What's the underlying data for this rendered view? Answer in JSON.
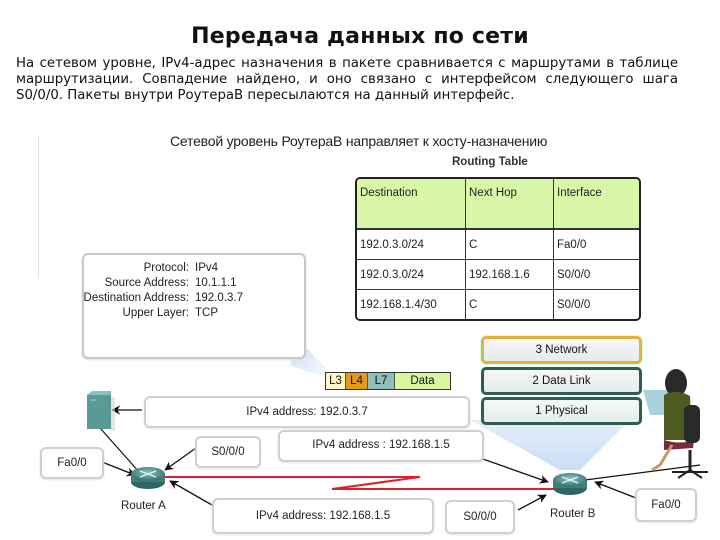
{
  "slide": {
    "title": "Передача данных по сети",
    "intro": "На сетевом уровне, IPv4-адрес назначения в пакете сравнивается с маршрутами в таблице маршрутизации. Совпадение найдено, и оно связано с интерфейсом следующего шага S0/0/0. Пакеты внутри РоутераB пересылаются на данный интерфейс.",
    "subtitle": "Сетевой уровень РоутераB направляет к хосту-назначению"
  },
  "routing_table": {
    "title": "Routing Table",
    "columns": [
      "Destination",
      "Next Hop",
      "Interface"
    ],
    "rows": [
      [
        "192.0.3.0/24",
        "C",
        "Fa0/0"
      ],
      [
        "192.0.3.0/24",
        "192.168.1.6",
        "S0/0/0"
      ],
      [
        "192.168.1.4/30",
        "C",
        "S0/0/0"
      ]
    ],
    "header_color": "#d8f7a8"
  },
  "packet_header": {
    "rows": [
      {
        "key": "Protocol:",
        "value": "IPv4"
      },
      {
        "key": "Source Address:",
        "value": "10.1.1.1"
      },
      {
        "key": "Destination Address:",
        "value": "192.0.3.7"
      },
      {
        "key": "Upper Layer:",
        "value": "TCP"
      }
    ]
  },
  "pdu": [
    {
      "label": "L3",
      "color": "#fdf7c9"
    },
    {
      "label": "L4",
      "color": "#e39a1c"
    },
    {
      "label": "L7",
      "color": "#8fc0b8"
    },
    {
      "label": "Data",
      "color": "#d6f7a0"
    }
  ],
  "osi_layers": [
    {
      "label": "3 Network",
      "active": true
    },
    {
      "label": "2 Data Link",
      "active": false
    },
    {
      "label": "1 Physical",
      "active": false
    }
  ],
  "topology": {
    "host_address": "IPv4 address: 192.0.3.7",
    "link_address_top": "IPv4 address : 192.168.1.5",
    "link_address_bottom": "IPv4 address: 192.168.1.5",
    "router_a": {
      "name": "Router A",
      "fa": "Fa0/0",
      "serial": "S0/0/0"
    },
    "router_b": {
      "name": "Router B",
      "fa": "Fa0/0",
      "serial": "S0/0/0"
    },
    "link_color": "#e0202a",
    "router_color": "#4f8f8c"
  }
}
